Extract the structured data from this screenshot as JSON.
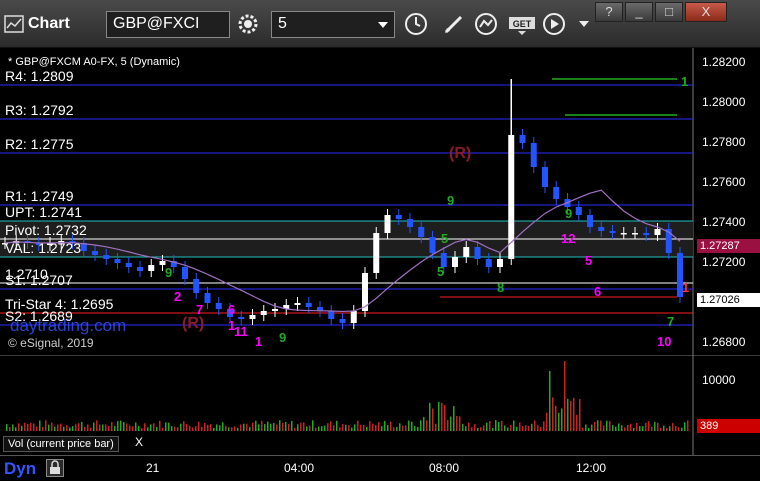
{
  "app": {
    "title": "Chart",
    "symbol": "GBP@FXCI",
    "interval": "5"
  },
  "window_buttons": {
    "help": "?",
    "minimize": "_",
    "maximize": "□",
    "close": "X"
  },
  "chart_header": "* GBP@FXCM A0-FX, 5 (Dynamic)",
  "copyright": "© eSignal, 2019",
  "watermark": "daytrading.com",
  "levels": [
    {
      "label": "R4: 1.2809",
      "value": 1.2809,
      "color": "#2b2bff"
    },
    {
      "label": "R3: 1.2792",
      "value": 1.2792,
      "color": "#2b2bff"
    },
    {
      "label": "R2: 1.2775",
      "value": 1.2775,
      "color": "#2b2bff"
    },
    {
      "label": "R1: 1.2749",
      "value": 1.2749,
      "color": "#2b2bff"
    },
    {
      "label": "UPT: 1.2741",
      "value": 1.2741,
      "color": "#20c0c0"
    },
    {
      "label": "Pivot: 1.2732",
      "value": 1.2732,
      "color": "#ffffff"
    },
    {
      "label": "VAL: 1.2723",
      "value": 1.2723,
      "color": "#20c0c0"
    },
    {
      "label": "1.2710",
      "value": 1.271,
      "color": "#ffffff"
    },
    {
      "label": "S1: 1.2707",
      "value": 1.2707,
      "color": "#2b2bff"
    },
    {
      "label": "Tri-Star 4: 1.2695",
      "value": 1.2695,
      "color": "#ff2020"
    },
    {
      "label": "S2: 1.2689",
      "value": 1.2689,
      "color": "#2b2bff"
    }
  ],
  "price_axis": [
    "1.28200",
    "1.28000",
    "1.27800",
    "1.27600",
    "1.27400",
    "1.27200",
    "1.27000",
    "1.26800"
  ],
  "current_price": "1.27026",
  "marker_price": "1.27287",
  "annotations": {
    "r_top": "(R)",
    "r_bottom": "(R)",
    "counts_magenta": [
      "2",
      "7",
      "6",
      "11",
      "1",
      "1",
      "12",
      "5",
      "6",
      "10",
      "1"
    ],
    "counts_green": [
      "9",
      "5",
      "9",
      "8",
      "5",
      "9",
      "9",
      "1",
      "7"
    ]
  },
  "volume": {
    "title": "Vol (current price bar)",
    "close": "X",
    "tick": "10000",
    "last": "389"
  },
  "time_axis": [
    "21",
    "04:00",
    "08:00",
    "12:00"
  ],
  "bottom": {
    "label": "Dyn"
  },
  "chart_data": {
    "type": "candlestick",
    "title": "GBP@FXCM A0-FX, 5 (Dynamic)",
    "ylim": [
      1.268,
      1.2825
    ],
    "x_ticks": [
      "21",
      "04:00",
      "08:00",
      "12:00"
    ],
    "close_series_approx": [
      1.273,
      1.2731,
      1.273,
      1.2729,
      1.273,
      1.2731,
      1.273,
      1.2726,
      1.2724,
      1.2722,
      1.272,
      1.2718,
      1.2716,
      1.2719,
      1.2721,
      1.2718,
      1.2712,
      1.2705,
      1.27,
      1.2697,
      1.2693,
      1.2692,
      1.2694,
      1.2696,
      1.2697,
      1.2699,
      1.27,
      1.2698,
      1.2696,
      1.2692,
      1.269,
      1.2696,
      1.2715,
      1.2735,
      1.2744,
      1.2742,
      1.2738,
      1.2733,
      1.2725,
      1.2718,
      1.2723,
      1.2728,
      1.2722,
      1.2718,
      1.2722,
      1.2784,
      1.278,
      1.2768,
      1.2758,
      1.2752,
      1.2748,
      1.2744,
      1.2738,
      1.2736,
      1.2735,
      1.2735,
      1.2735,
      1.2734,
      1.2737,
      1.2725,
      1.2703
    ],
    "volume_tick": 10000,
    "volume_last": 389
  }
}
